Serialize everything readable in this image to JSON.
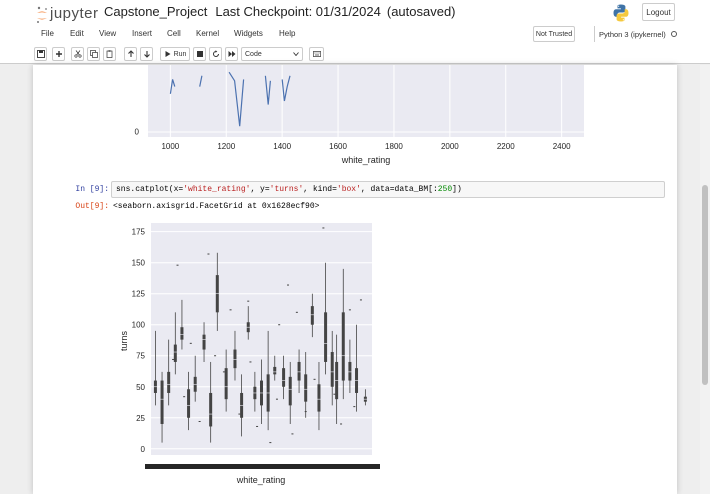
{
  "header": {
    "logo_text": "jupyter",
    "notebook_name": "Capstone_Project",
    "checkpoint": "Last Checkpoint: 01/31/2024",
    "autosave": "(autosaved)",
    "logout_label": "Logout"
  },
  "menu": [
    "File",
    "Edit",
    "View",
    "Insert",
    "Cell",
    "Kernel",
    "Widgets",
    "Help"
  ],
  "status": {
    "trust": "Not Trusted",
    "kernel": "Python 3 (ipykernel)"
  },
  "toolbar": {
    "run_label": "Run",
    "cell_type": "Code"
  },
  "cell": {
    "in_prompt": "In [9]:",
    "out_prompt": "Out[9]:",
    "code": {
      "fn": "sns.catplot(",
      "arg1": "x=",
      "val1": "'white_rating'",
      "sep": ", ",
      "arg2": "y=",
      "val2": "'turns'",
      "arg3": "kind=",
      "val3": "'box'",
      "arg4": "data=",
      "var4": "data_BM[:",
      "num": "250",
      "close": "])"
    },
    "output": "<seaborn.axisgrid.FacetGrid at 0x1628ecf90>"
  },
  "chart_data": [
    {
      "type": "line",
      "title": "",
      "xlabel": "white_rating",
      "ylabel": "",
      "x_ticks": [
        1000,
        1200,
        1400,
        1600,
        1800,
        2000,
        2200,
        2400
      ],
      "y_ticks": [
        0
      ],
      "xlim": [
        920,
        2480
      ],
      "partial_view": true,
      "series_color": "#4c72b0",
      "series": [
        {
          "x": [
            1000,
            1008,
            1016,
            1105,
            1113,
            1210,
            1230,
            1248,
            1262,
            1340,
            1350,
            1358,
            1400,
            1408,
            1418,
            1428
          ],
          "y": [
            0.6,
            0.8,
            0.7,
            0.7,
            0.85,
            0.9,
            0.78,
            0.15,
            0.8,
            0.85,
            0.45,
            0.78,
            0.8,
            0.5,
            0.7,
            0.85
          ]
        }
      ]
    },
    {
      "type": "box",
      "title": "",
      "xlabel": "white_rating",
      "ylabel": "turns",
      "y_ticks": [
        0,
        25,
        50,
        75,
        100,
        125,
        150,
        175
      ],
      "ylim": [
        -5,
        182
      ],
      "box_color": "#444444",
      "note": "about 250 overlapping categorical boxes; x tick labels overlap into an unreadable band",
      "boxes": [
        {
          "x": 0.02,
          "low": 35,
          "q1": 45,
          "med": 50,
          "q3": 55,
          "high": 95
        },
        {
          "x": 0.05,
          "low": 5,
          "q1": 20,
          "med": 40,
          "q3": 55,
          "high": 62
        },
        {
          "x": 0.08,
          "low": 35,
          "q1": 45,
          "med": 52,
          "q3": 62,
          "high": 88
        },
        {
          "x": 0.11,
          "low": 60,
          "q1": 70,
          "med": 78,
          "q3": 84,
          "high": 110
        },
        {
          "x": 0.14,
          "low": 80,
          "q1": 88,
          "med": 92,
          "q3": 98,
          "high": 120
        },
        {
          "x": 0.17,
          "low": 15,
          "q1": 25,
          "med": 35,
          "q3": 48,
          "high": 62
        },
        {
          "x": 0.2,
          "low": 38,
          "q1": 46,
          "med": 52,
          "q3": 58,
          "high": 75
        },
        {
          "x": 0.24,
          "low": 70,
          "q1": 80,
          "med": 88,
          "q3": 92,
          "high": 102
        },
        {
          "x": 0.27,
          "low": 5,
          "q1": 18,
          "med": 28,
          "q3": 45,
          "high": 70
        },
        {
          "x": 0.3,
          "low": 95,
          "q1": 110,
          "med": 125,
          "q3": 140,
          "high": 158
        },
        {
          "x": 0.34,
          "low": 30,
          "q1": 40,
          "med": 50,
          "q3": 65,
          "high": 80
        },
        {
          "x": 0.38,
          "low": 55,
          "q1": 65,
          "med": 72,
          "q3": 80,
          "high": 95
        },
        {
          "x": 0.41,
          "low": 10,
          "q1": 25,
          "med": 35,
          "q3": 45,
          "high": 60
        },
        {
          "x": 0.44,
          "low": 88,
          "q1": 94,
          "med": 98,
          "q3": 102,
          "high": 115
        },
        {
          "x": 0.47,
          "low": 30,
          "q1": 40,
          "med": 45,
          "q3": 50,
          "high": 62
        },
        {
          "x": 0.5,
          "low": 20,
          "q1": 35,
          "med": 45,
          "q3": 55,
          "high": 72
        },
        {
          "x": 0.53,
          "low": 15,
          "q1": 30,
          "med": 45,
          "q3": 60,
          "high": 95
        },
        {
          "x": 0.56,
          "low": 55,
          "q1": 60,
          "med": 62,
          "q3": 66,
          "high": 75
        },
        {
          "x": 0.6,
          "low": 40,
          "q1": 50,
          "med": 55,
          "q3": 65,
          "high": 75
        },
        {
          "x": 0.63,
          "low": 20,
          "q1": 35,
          "med": 48,
          "q3": 58,
          "high": 70
        },
        {
          "x": 0.67,
          "low": 45,
          "q1": 55,
          "med": 62,
          "q3": 70,
          "high": 80
        },
        {
          "x": 0.7,
          "low": 25,
          "q1": 38,
          "med": 48,
          "q3": 60,
          "high": 78
        },
        {
          "x": 0.73,
          "low": 90,
          "q1": 100,
          "med": 108,
          "q3": 115,
          "high": 125
        },
        {
          "x": 0.76,
          "low": 15,
          "q1": 30,
          "med": 40,
          "q3": 52,
          "high": 70
        },
        {
          "x": 0.79,
          "low": 60,
          "q1": 70,
          "med": 85,
          "q3": 110,
          "high": 150
        },
        {
          "x": 0.82,
          "low": 35,
          "q1": 50,
          "med": 62,
          "q3": 78,
          "high": 95
        },
        {
          "x": 0.84,
          "low": 20,
          "q1": 40,
          "med": 55,
          "q3": 70,
          "high": 92
        },
        {
          "x": 0.87,
          "low": 40,
          "q1": 55,
          "med": 75,
          "q3": 110,
          "high": 145
        },
        {
          "x": 0.9,
          "low": 45,
          "q1": 55,
          "med": 62,
          "q3": 70,
          "high": 88
        },
        {
          "x": 0.93,
          "low": 30,
          "q1": 45,
          "med": 55,
          "q3": 65,
          "high": 100
        },
        {
          "x": 0.97,
          "low": 35,
          "q1": 38,
          "med": 40,
          "q3": 42,
          "high": 48
        }
      ],
      "outliers": [
        {
          "x": 0.26,
          "y": 157
        },
        {
          "x": 0.12,
          "y": 148
        },
        {
          "x": 0.44,
          "y": 119
        },
        {
          "x": 0.62,
          "y": 132
        },
        {
          "x": 0.78,
          "y": 178
        },
        {
          "x": 0.95,
          "y": 120
        },
        {
          "x": 0.66,
          "y": 110
        },
        {
          "x": 0.36,
          "y": 112
        },
        {
          "x": 0.18,
          "y": 85
        },
        {
          "x": 0.58,
          "y": 100
        },
        {
          "x": 0.29,
          "y": 75
        },
        {
          "x": 0.9,
          "y": 112
        },
        {
          "x": 0.1,
          "y": 72
        },
        {
          "x": 0.4,
          "y": 28
        },
        {
          "x": 0.48,
          "y": 18
        },
        {
          "x": 0.64,
          "y": 12
        },
        {
          "x": 0.54,
          "y": 5
        },
        {
          "x": 0.22,
          "y": 22
        },
        {
          "x": 0.33,
          "y": 62
        },
        {
          "x": 0.7,
          "y": 30
        },
        {
          "x": 0.86,
          "y": 20
        },
        {
          "x": 0.15,
          "y": 42
        },
        {
          "x": 0.45,
          "y": 70
        },
        {
          "x": 0.74,
          "y": 56
        },
        {
          "x": 0.57,
          "y": 40
        },
        {
          "x": 0.83,
          "y": 44
        },
        {
          "x": 0.92,
          "y": 34
        }
      ]
    }
  ]
}
